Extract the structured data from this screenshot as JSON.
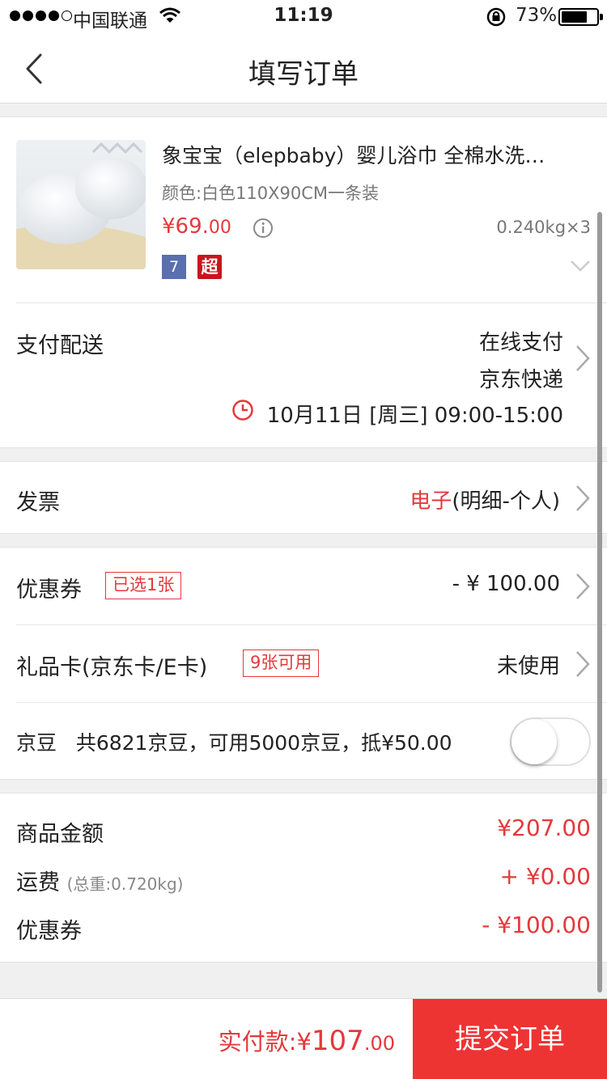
{
  "status_bar": {
    "carrier": "中国联通",
    "time": "11:19",
    "battery_percent": "73%",
    "battery_level": 0.73
  },
  "nav": {
    "title": "填写订单",
    "back_icon": "chevron-left-icon"
  },
  "product": {
    "name": "象宝宝（elepbaby）婴儿浴巾 全棉水洗…",
    "spec": "颜色:白色110X90CM一条装",
    "price_main": "¥69.",
    "price_cents": "00",
    "weight_qty": "0.240kg×3",
    "tag_7": "7",
    "tag_chao": "超"
  },
  "payment_delivery": {
    "label": "支付配送",
    "payment": "在线支付",
    "delivery": "京东快递",
    "time_slot": "10月11日 [周三] 09:00-15:00"
  },
  "invoice": {
    "label": "发票",
    "type_red": "电子",
    "type_rest": "(明细-个人)"
  },
  "coupon": {
    "label": "优惠券",
    "badge": "已选1张",
    "value": "- ¥ 100.00"
  },
  "giftcard": {
    "label": "礼品卡(京东卡/E卡)",
    "badge": "9张可用",
    "value": "未使用"
  },
  "jingdou": {
    "text": "京豆   共6821京豆，可用5000京豆，抵¥50.00",
    "toggle_on": false
  },
  "summary": {
    "goods_label": "商品金额",
    "goods_value": "¥207.00",
    "freight_label": "运费",
    "freight_note": "(总重:0.720kg)",
    "freight_value": "+ ¥0.00",
    "coupon_label": "优惠券",
    "coupon_value": "- ¥100.00"
  },
  "bottom": {
    "pay_prefix": "实付款:¥",
    "pay_int": "107",
    "pay_dec": ".00",
    "submit": "提交订单"
  },
  "colors": {
    "accent": "#e4393c",
    "submit_bg": "#ee3333"
  }
}
